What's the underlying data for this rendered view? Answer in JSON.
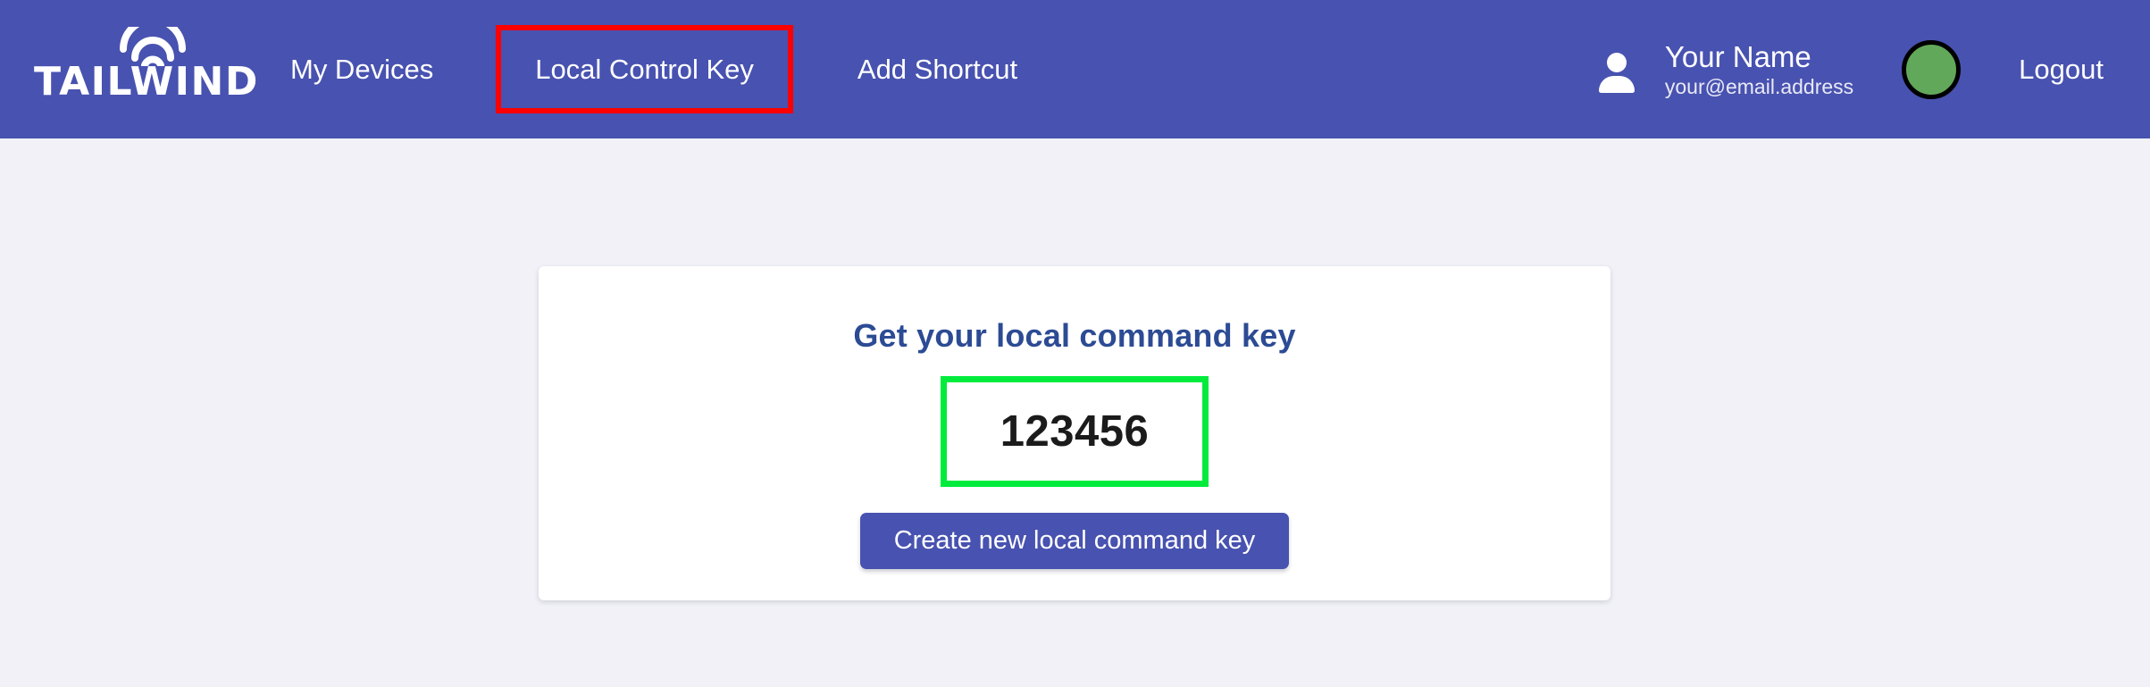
{
  "header": {
    "background_color": "#4852b0",
    "logo": {
      "wordmark": "TAILWIND",
      "icon": "wifi-arcs-icon"
    },
    "nav": {
      "items": [
        {
          "label": "My Devices",
          "name": "my-devices",
          "highlighted": false
        },
        {
          "label": "Local Control Key",
          "name": "local-control-key",
          "highlighted": true
        },
        {
          "label": "Add Shortcut",
          "name": "add-shortcut",
          "highlighted": false
        }
      ],
      "highlight_color": "#fe0000"
    },
    "user": {
      "icon": "person-icon",
      "name": "Your Name",
      "email": "your@email.address",
      "avatar_color": "#62a85a",
      "avatar_border_color": "#000000",
      "logout_label": "Logout"
    }
  },
  "main": {
    "background_color": "#f1f1f7",
    "card": {
      "title": "Get your local command key",
      "title_color": "#2c4b94",
      "key_value": "123456",
      "key_box_border_color": "#00eb3c",
      "button_label": "Create new local command key",
      "button_color": "#4852b0"
    }
  }
}
